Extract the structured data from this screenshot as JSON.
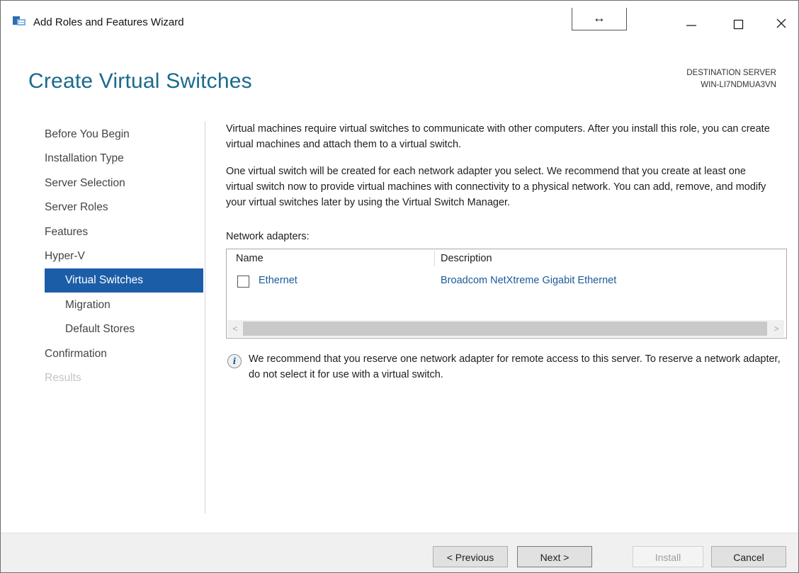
{
  "window": {
    "title": "Add Roles and Features Wizard",
    "resize_glyph": "↔",
    "controls": [
      "minimize-icon",
      "maximize-icon",
      "close-icon"
    ]
  },
  "header": {
    "page_title": "Create Virtual Switches",
    "destination_label": "DESTINATION SERVER",
    "destination_server": "WIN-LI7NDMUA3VN"
  },
  "nav": {
    "items": [
      {
        "label": "Before You Begin",
        "state": "normal"
      },
      {
        "label": "Installation Type",
        "state": "normal"
      },
      {
        "label": "Server Selection",
        "state": "normal"
      },
      {
        "label": "Server Roles",
        "state": "normal"
      },
      {
        "label": "Features",
        "state": "normal"
      },
      {
        "label": "Hyper-V",
        "state": "normal"
      },
      {
        "label": "Virtual Switches",
        "state": "active"
      },
      {
        "label": "Migration",
        "state": "normal"
      },
      {
        "label": "Default Stores",
        "state": "normal"
      },
      {
        "label": "Confirmation",
        "state": "normal"
      },
      {
        "label": "Results",
        "state": "disabled"
      }
    ]
  },
  "content": {
    "para1": "Virtual machines require virtual switches to communicate with other computers. After you install this role, you can create virtual machines and attach them to a virtual switch.",
    "para2": "One virtual switch will be created for each network adapter you select. We recommend that you create at least one virtual switch now to provide virtual machines with connectivity to a physical network. You can add, remove, and modify your virtual switches later by using the Virtual Switch Manager.",
    "adapters_label": "Network adapters:",
    "columns": {
      "name": "Name",
      "description": "Description"
    },
    "rows": [
      {
        "name": "Ethernet",
        "description": "Broadcom NetXtreme Gigabit Ethernet",
        "checked": false
      }
    ],
    "scroll_left": "<",
    "scroll_right": ">",
    "info_glyph": "i",
    "info_text": "We recommend that you reserve one network adapter for remote access to this server. To reserve a network adapter, do not select it for use with a virtual switch."
  },
  "footer": {
    "previous": "< Previous",
    "next": "Next >",
    "install": "Install",
    "cancel": "Cancel"
  },
  "colors": {
    "title_accent": "#1a6a8e",
    "nav_active": "#1c5da8",
    "link_blue": "#1a5a9c"
  }
}
